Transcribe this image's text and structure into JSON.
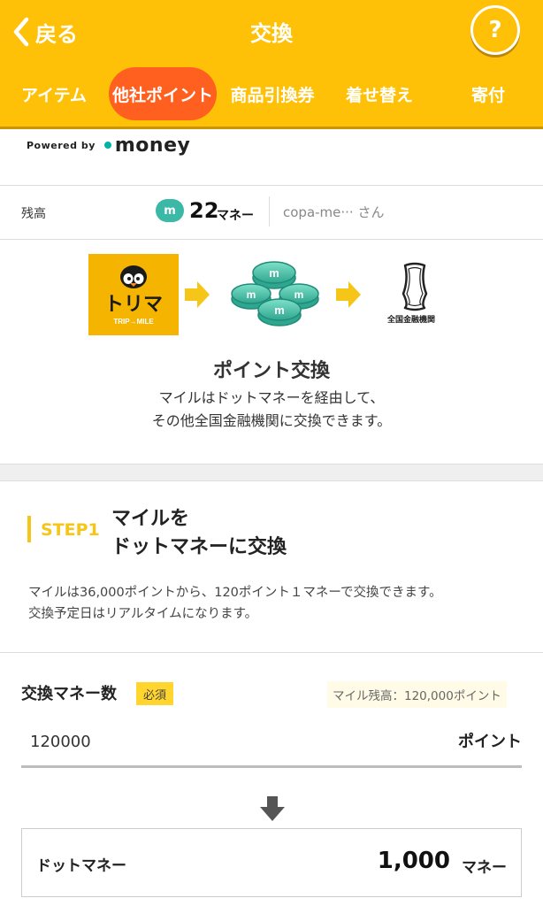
{
  "header": {
    "back_label": "戻る",
    "title": "交換",
    "help_label": "?",
    "tabs": [
      {
        "label": "アイテム"
      },
      {
        "label": "他社ポイント"
      },
      {
        "label": "商品引換券"
      },
      {
        "label": "着せ替え"
      },
      {
        "label": "寄付"
      }
    ],
    "active_tab": "他社ポイント",
    "accent_color": "#FFC107",
    "active_tab_color": "#FF5F1F"
  },
  "powered": {
    "prefix": "Powered by",
    "brand": "money"
  },
  "balance": {
    "label": "残高",
    "logo": "m",
    "amount": "22",
    "unit": "マネー",
    "user": "copa-me··· さん"
  },
  "flow": {
    "source_brand": "トリマ",
    "source_sub": "TRIP→MILE",
    "middle_icon": "coins-icon",
    "destination_label": "全国金融機関",
    "title": "ポイント交換",
    "desc_line1": "マイルはドットマネーを経由して、",
    "desc_line2": "その他全国金融機関に交換できます。"
  },
  "step": {
    "label": "STEP1",
    "title_line1": "マイルを",
    "title_line2": "ドットマネーに交換",
    "desc_line1": "マイルは36,000ポイントから、120ポイント１マネーで交換できます。",
    "desc_line2": "交換予定日はリアルタイムになります。"
  },
  "exchange": {
    "label": "交換マネー数",
    "required_badge": "必須",
    "mile_balance": "マイル残高：120,000ポイント",
    "input_value": "120000",
    "input_unit": "ポイント",
    "result_label": "ドットマネー",
    "result_value": "1,000",
    "result_unit": "マネー"
  }
}
